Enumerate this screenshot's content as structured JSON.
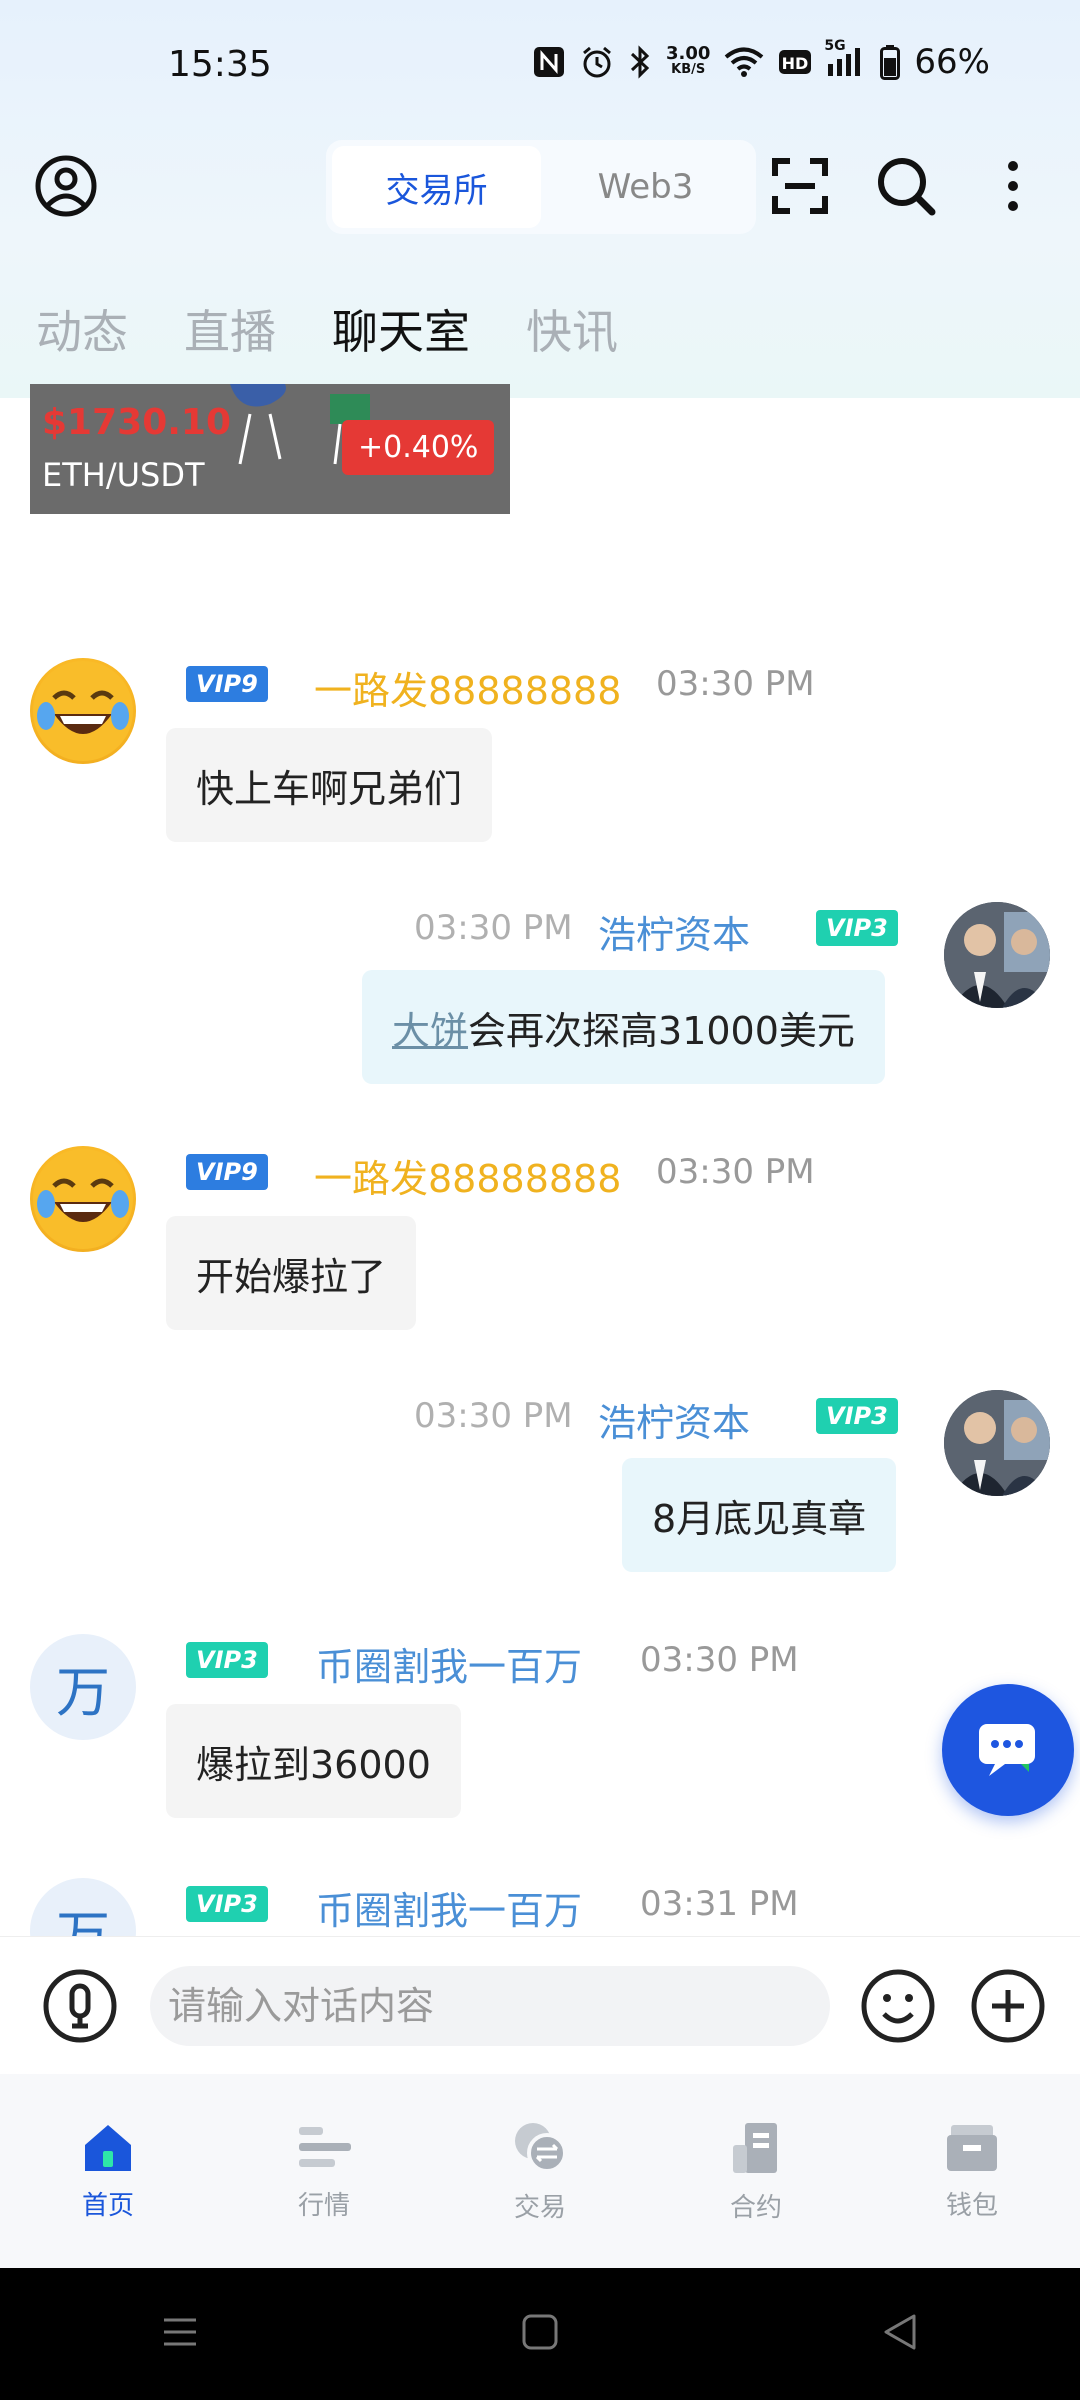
{
  "status_bar": {
    "time": "15:35",
    "net_speed_top": "3.00",
    "net_speed_bottom": "KB/S",
    "signal_label": "5G",
    "battery": "66%"
  },
  "header": {
    "segments": [
      {
        "label": "交易所",
        "active": true
      },
      {
        "label": "Web3",
        "active": false
      }
    ]
  },
  "tabs": [
    {
      "label": "动态",
      "active": false
    },
    {
      "label": "直播",
      "active": false
    },
    {
      "label": "聊天室",
      "active": true
    },
    {
      "label": "快讯",
      "active": false
    }
  ],
  "ticker": {
    "price": "$1730.10",
    "pair": "ETH/USDT",
    "change": "+0.40%"
  },
  "messages": [
    {
      "side": "left",
      "avatar": "laughing-emoji",
      "vip": "VIP9",
      "name": "一路发88888888",
      "time": "03:30 PM",
      "text": "快上车啊兄弟们"
    },
    {
      "side": "right",
      "avatar": "photo",
      "vip": "VIP3",
      "name": "浩柠资本",
      "time": "03:30 PM",
      "text_link": "大饼",
      "text": "会再次探高31000美元"
    },
    {
      "side": "left",
      "avatar": "laughing-emoji",
      "vip": "VIP9",
      "name": "一路发88888888",
      "time": "03:30 PM",
      "text": "开始爆拉了"
    },
    {
      "side": "right",
      "avatar": "photo",
      "vip": "VIP3",
      "name": "浩柠资本",
      "time": "03:30 PM",
      "text": "8月底见真章"
    },
    {
      "side": "left",
      "avatar": "万",
      "vip": "VIP3",
      "name": "币圈割我一百万",
      "time": "03:30 PM",
      "text": "爆拉到36000"
    },
    {
      "side": "left",
      "avatar": "万",
      "vip": "VIP3",
      "name": "币圈割我一百万",
      "time": "03:31 PM",
      "text": ""
    }
  ],
  "input": {
    "placeholder": "请输入对话内容"
  },
  "bottom_nav": [
    {
      "label": "首页",
      "icon": "home-icon",
      "active": true
    },
    {
      "label": "行情",
      "icon": "market-icon",
      "active": false
    },
    {
      "label": "交易",
      "icon": "trade-icon",
      "active": false
    },
    {
      "label": "合约",
      "icon": "contract-icon",
      "active": false
    },
    {
      "label": "钱包",
      "icon": "wallet-icon",
      "active": false
    }
  ],
  "colors": {
    "accent": "#1a56db",
    "vip9": "#2d7de0",
    "vip3": "#1fd0b0",
    "name_yellow": "#f0b21f",
    "name_blue": "#4a8fd6",
    "price_red": "#e53935"
  }
}
